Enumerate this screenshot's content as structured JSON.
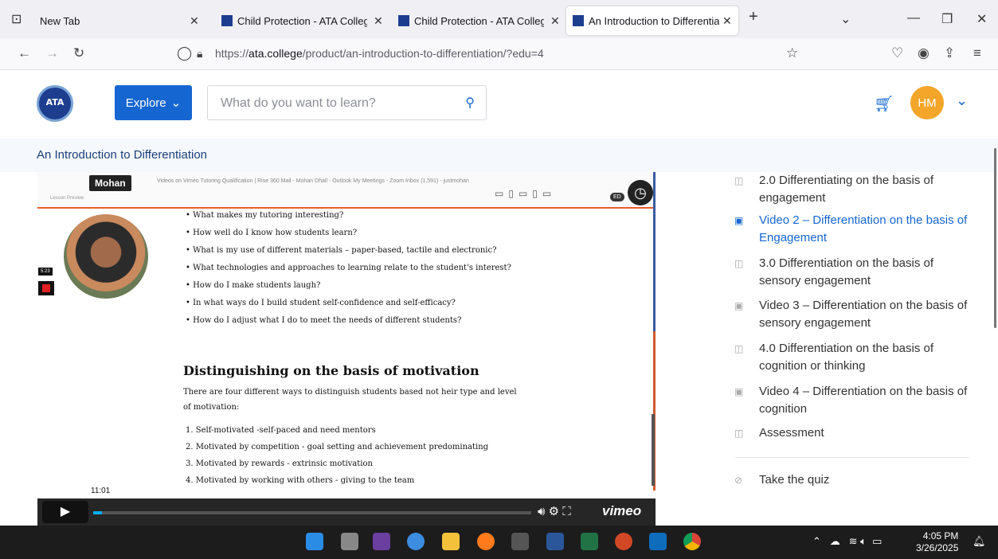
{
  "browser": {
    "tabs": [
      {
        "label": "New Tab"
      },
      {
        "label": "Child Protection - ATA College"
      },
      {
        "label": "Child Protection - ATA College"
      },
      {
        "label": "An Introduction to Differentiatic"
      }
    ],
    "url_prefix": "https://",
    "url_domain": "ata.college",
    "url_path": "/product/an-introduction-to-differentiation/?edu=4"
  },
  "header": {
    "logo_text": "ATA",
    "explore_label": "Explore",
    "search_placeholder": "What do you want to learn?",
    "avatar_initials": "HM",
    "accent": "#1666d1",
    "avatar_color": "#f4a62a"
  },
  "course": {
    "title": "An Introduction to Differentiation"
  },
  "video": {
    "presenter_name": "Mohan",
    "lesson_preview": "Lesson Preview",
    "browser_tabs_text": "Videos on Vimeo    Tutoring Qualification | Rise 360    Mail - Mohan Dhall - Outlook    My Meetings - Zoom    Inbox (1,591) - justmohan",
    "rec_timer": "5:23",
    "ed_label": "ED",
    "bullets": [
      "• What makes my tutoring interesting?",
      "• How well do I know how students learn?",
      "• What is my use of different materials – paper-based, tactile and electronic?",
      "• What technologies and approaches to learning relate to the student's interest?",
      "• How do I make students laugh?",
      "• In what ways do I build student self-confidence and self-efficacy?",
      "• How do I adjust what I do to meet the needs of different students?"
    ],
    "heading": "Distinguishing on the basis of motivation",
    "paragraph": "There are four different ways to distinguish students based not heir type and level of motivation:",
    "numbered": [
      "1.  Self-motivated -self-paced and need mentors",
      "2.  Motivated by competition - goal setting and achievement predominating",
      "3.  Motivated by rewards - extrinsic motivation",
      "4.  Motivated by working with others - giving to the team"
    ],
    "time_tooltip": "11:01",
    "progress_fraction": 0.02,
    "brand": "vimeo"
  },
  "sidebar": {
    "items": [
      {
        "icon": "book-icon",
        "text": "2.0     Differentiating on the basis of engagement",
        "active": false
      },
      {
        "icon": "video-icon",
        "text": "Video 2 – Differentiation on the basis of Engagement",
        "active": true
      },
      {
        "icon": "book-icon",
        "text": "3.0     Differentiation on the basis of sensory engagement",
        "active": false
      },
      {
        "icon": "video-icon",
        "text": "Video 3 – Differentiation on the basis of sensory engagement",
        "active": false
      },
      {
        "icon": "book-icon",
        "text": "4.0     Differentiation on the basis of cognition or thinking",
        "active": false
      },
      {
        "icon": "video-icon",
        "text": "Video 4 – Differentiation on the basis of cognition",
        "active": false
      },
      {
        "icon": "book-icon",
        "text": "Assessment",
        "active": false
      }
    ],
    "quiz_label": "Take the quiz"
  },
  "taskbar": {
    "time": "4:05 PM",
    "date": "3/26/2025"
  }
}
